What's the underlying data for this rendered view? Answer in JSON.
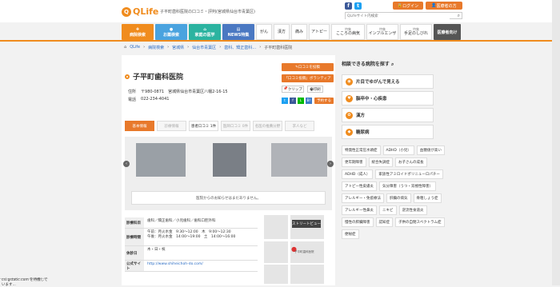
{
  "brand": {
    "logo_text": "QLife",
    "tagline": "子平町歯科医院の口コミ・評判(宮城県仙台市青葉区)",
    "accent": "#f08c1e"
  },
  "header": {
    "login": "ログイン",
    "medical": "医療者の方",
    "search_placeholder": "QLifeサイト内検索"
  },
  "nav": [
    {
      "label": "病院検索",
      "color": "#f08c1e"
    },
    {
      "label": "お薬検索",
      "color": "#4aa3df"
    },
    {
      "label": "家庭の医学",
      "color": "#2bb3a0"
    },
    {
      "label": "NEWS特集",
      "color": "#4a78c2"
    }
  ],
  "nav_plain": [
    {
      "label": "がん",
      "sub": ""
    },
    {
      "label": "漢方",
      "sub": ""
    },
    {
      "label": "痛み",
      "sub": ""
    },
    {
      "label": "アトピー",
      "sub": ""
    },
    {
      "label": "こころの病気",
      "sub": "特集"
    },
    {
      "label": "インフルエンザ",
      "sub": "特集"
    },
    {
      "label": "手足のしびれ",
      "sub": "特集"
    }
  ],
  "nav_dark": {
    "label": "医療者向け",
    "color": "#555"
  },
  "breadcrumb": [
    "QLife",
    "病院検索",
    "宮城県",
    "仙台市青葉区",
    "歯科、矯正歯科…",
    "子平町歯科医院"
  ],
  "clinic": {
    "name": "子平町歯科医院",
    "address_label": "住所",
    "address": "〒980-0871　宮城県仙台市青葉区八幡2-16-15",
    "phone_label": "電話",
    "phone": "022-234-4041"
  },
  "actions": {
    "review": "口コミを投稿",
    "volunteer": "「口コミ投稿」ボランティア",
    "clip": "クリップ",
    "print": "印刷",
    "reserve": "予約する"
  },
  "tabs": [
    "基本情報",
    "診療情報",
    "患者口コミ 1件",
    "医師口コミ 0件",
    "名医の推薦分野",
    "求人など"
  ],
  "gallery": {
    "notice": "医院からのお知らせはまだありません。"
  },
  "details": [
    {
      "label": "診療科目",
      "value": "歯科／矯正歯科／小児歯科／歯科口腔外科"
    },
    {
      "label": "診療時間",
      "value": "午前：月火水金　9:30〜12:00　木　9:00〜12:30\n午後：月火水金　14:00〜19:00　土　14:00〜16:00"
    },
    {
      "label": "休診日",
      "value": "木・日・祝"
    },
    {
      "label": "公式サイト",
      "value": "http://www.shiheichoh-do.com/"
    }
  ],
  "map": {
    "street_view": "ストリートビュー",
    "place": "子平町歯科医院"
  },
  "sidebar": {
    "title": "相談できる病院を探す",
    "items": [
      {
        "label": "片目でゆがんで見える",
        "icon": "eye-icon"
      },
      {
        "label": "脳卒中・心疾患",
        "icon": "heart-icon"
      },
      {
        "label": "漢方",
        "icon": "leaf-icon"
      },
      {
        "label": "糖尿病",
        "icon": "drop-icon"
      }
    ],
    "tags": [
      "特発性正常圧水頭症",
      "ADHD（小児）",
      "血糖値が高い",
      "更年期障害",
      "統合失調症",
      "お子さんの成長",
      "ADHD（成人）",
      "家族性アミロイドポリニューロパチー",
      "アトピー性皮膚炎",
      "気分障害（うつ・双極性障害）",
      "アレルギー・免疫療法",
      "肝臓の病気",
      "骨粗しょう症",
      "アレルギー性鼻炎",
      "ニキビ",
      "逆流性食道炎",
      "慢性の膵臓障害",
      "認知症",
      "子供の自閉スペクトラム症",
      "便秘症"
    ]
  },
  "status": "csi.gstatic.com を待機しています..."
}
